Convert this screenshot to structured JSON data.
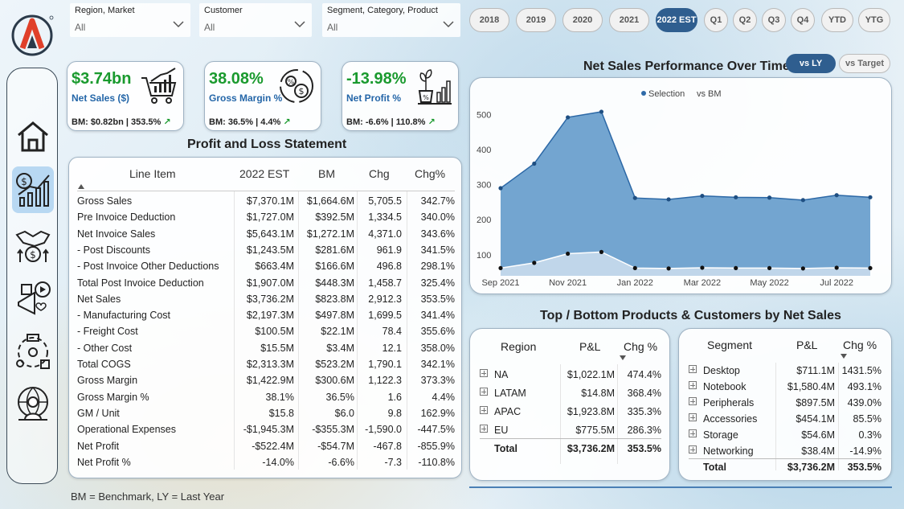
{
  "filters": [
    {
      "label": "Region, Market",
      "value": "All"
    },
    {
      "label": "Customer",
      "value": "All"
    },
    {
      "label": "Segment, Category, Product",
      "value": "All"
    }
  ],
  "periods": [
    {
      "label": "2018",
      "active": false
    },
    {
      "label": "2019",
      "active": false
    },
    {
      "label": "2020",
      "active": false
    },
    {
      "label": "2021",
      "active": false
    },
    {
      "label": "2022 EST",
      "active": true
    },
    {
      "label": "Q1",
      "active": false
    },
    {
      "label": "Q2",
      "active": false
    },
    {
      "label": "Q3",
      "active": false
    },
    {
      "label": "Q4",
      "active": false
    },
    {
      "label": "YTD",
      "active": false
    },
    {
      "label": "YTG",
      "active": false
    }
  ],
  "nav": {
    "items": [
      {
        "icon": "home-icon",
        "active": false
      },
      {
        "icon": "finance-view-icon",
        "active": true
      },
      {
        "icon": "sales-view-icon",
        "active": false
      },
      {
        "icon": "marketing-view-icon",
        "active": false
      },
      {
        "icon": "supply-chain-icon",
        "active": false
      },
      {
        "icon": "executive-view-icon",
        "active": false
      }
    ]
  },
  "kpis": [
    {
      "value": "$3.74bn",
      "name": "Net Sales ($)",
      "bm": "BM: $0.82bn | 353.5%",
      "icon": "shopping-cart-chart-icon"
    },
    {
      "value": "38.08%",
      "name": "Gross Margin %",
      "bm": "BM: 36.5% | 4.4%",
      "icon": "margin-percent-icon"
    },
    {
      "value": "-13.98%",
      "name": "Net Profit %",
      "bm": "BM: -6.6% | 110.8%",
      "icon": "profit-growth-icon"
    }
  ],
  "pl": {
    "title": "Profit and Loss Statement",
    "headers": [
      "Line Item",
      "2022 EST",
      "BM",
      "Chg",
      "Chg%"
    ],
    "rows": [
      [
        "Gross Sales",
        "$7,370.1M",
        "$1,664.6M",
        "5,705.5",
        "342.7%"
      ],
      [
        "Pre Invoice Deduction",
        "$1,727.0M",
        "$392.5M",
        "1,334.5",
        "340.0%"
      ],
      [
        "Net Invoice Sales",
        "$5,643.1M",
        "$1,272.1M",
        "4,371.0",
        "343.6%"
      ],
      [
        "- Post Discounts",
        "$1,243.5M",
        "$281.6M",
        "961.9",
        "341.5%"
      ],
      [
        "- Post Invoice Other Deductions",
        "$663.4M",
        "$166.6M",
        "496.8",
        "298.1%"
      ],
      [
        "Total Post Invoice Deduction",
        "$1,907.0M",
        "$448.3M",
        "1,458.7",
        "325.4%"
      ],
      [
        "Net Sales",
        "$3,736.2M",
        "$823.8M",
        "2,912.3",
        "353.5%"
      ],
      [
        "- Manufacturing Cost",
        "$2,197.3M",
        "$497.8M",
        "1,699.5",
        "341.4%"
      ],
      [
        "- Freight Cost",
        "$100.5M",
        "$22.1M",
        "78.4",
        "355.6%"
      ],
      [
        "- Other Cost",
        "$15.5M",
        "$3.4M",
        "12.1",
        "358.0%"
      ],
      [
        "Total COGS",
        "$2,313.3M",
        "$523.2M",
        "1,790.1",
        "342.1%"
      ],
      [
        "Gross Margin",
        "$1,422.9M",
        "$300.6M",
        "1,122.3",
        "373.3%"
      ],
      [
        "Gross Margin %",
        "38.1%",
        "36.5%",
        "1.6",
        "4.4%"
      ],
      [
        "GM / Unit",
        "$15.8",
        "$6.0",
        "9.8",
        "162.9%"
      ],
      [
        "Operational Expenses",
        "-$1,945.3M",
        "-$355.3M",
        "-1,590.0",
        "-447.5%"
      ],
      [
        "Net Profit",
        "-$522.4M",
        "-$54.7M",
        "-467.8",
        "-855.9%"
      ],
      [
        "Net Profit %",
        "-14.0%",
        "-6.6%",
        "-7.3",
        "-110.8%"
      ]
    ]
  },
  "chart": {
    "title": "Net Sales Performance Over Time",
    "toggle_ly": "vs LY",
    "toggle_target": "vs Target"
  },
  "chart_data": {
    "type": "area",
    "x": [
      "Sep 2021",
      "Oct 2021",
      "Nov 2021",
      "Dec 2021",
      "Jan 2022",
      "Feb 2022",
      "Mar 2022",
      "Apr 2022",
      "May 2022",
      "Jun 2022",
      "Jul 2022",
      "Aug 2022"
    ],
    "xticks": [
      "Sep 2021",
      "Nov 2021",
      "Jan 2022",
      "Mar 2022",
      "May 2022",
      "Jul 2022"
    ],
    "series": [
      {
        "name": "Selection",
        "values": [
          290,
          360,
          492,
          508,
          262,
          258,
          268,
          264,
          263,
          256,
          270,
          264
        ]
      },
      {
        "name": "vs BM",
        "values": [
          62,
          77,
          103,
          108,
          62,
          61,
          63,
          62,
          62,
          61,
          63,
          62
        ]
      }
    ],
    "ylim": [
      40,
      540
    ],
    "yticks": [
      100,
      200,
      300,
      400,
      500
    ],
    "grid": false,
    "legend": "top-center"
  },
  "region_table": {
    "title": "Top / Bottom Products & Customers by Net Sales",
    "headers": [
      "Region",
      "P&L",
      "Chg %"
    ],
    "rows": [
      [
        "NA",
        "$1,022.1M",
        "474.4%"
      ],
      [
        "LATAM",
        "$14.8M",
        "368.4%"
      ],
      [
        "APAC",
        "$1,923.8M",
        "335.3%"
      ],
      [
        "EU",
        "$775.5M",
        "286.3%"
      ]
    ],
    "total": [
      "Total",
      "$3,736.2M",
      "353.5%"
    ]
  },
  "segment_table": {
    "headers": [
      "Segment",
      "P&L",
      "Chg %"
    ],
    "rows": [
      [
        "Desktop",
        "$711.1M",
        "1431.5%"
      ],
      [
        "Notebook",
        "$1,580.4M",
        "493.1%"
      ],
      [
        "Peripherals",
        "$897.5M",
        "439.0%"
      ],
      [
        "Accessories",
        "$454.1M",
        "85.5%"
      ],
      [
        "Storage",
        "$54.6M",
        "0.3%"
      ],
      [
        "Networking",
        "$38.4M",
        "-14.9%"
      ]
    ],
    "total": [
      "Total",
      "$3,736.2M",
      "353.5%"
    ]
  },
  "footer": "BM = Benchmark, LY = Last Year",
  "colors": {
    "accent": "#2f5e8f",
    "positive": "#1a9a2e",
    "label": "#2466a8",
    "area": "#5b95c8"
  }
}
